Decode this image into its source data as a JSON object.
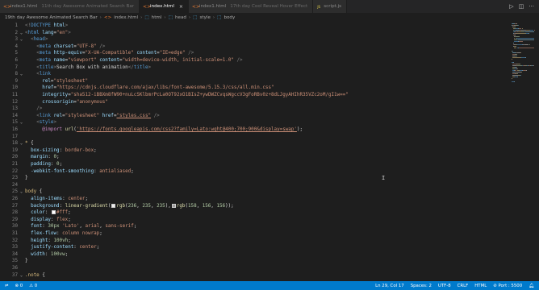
{
  "tabs": [
    {
      "label": "index1.html",
      "hint": "11th day Awesome Animated Search Bar",
      "icon": "html-icon",
      "active": false
    },
    {
      "label": "index.html",
      "hint": "",
      "icon": "html-icon",
      "active": true
    },
    {
      "label": "index1.html",
      "hint": "17th day Cool Reveal Hover Effect",
      "icon": "html-icon",
      "active": false
    },
    {
      "label": "script.js",
      "hint": "",
      "icon": "js-icon",
      "active": false
    }
  ],
  "tab_actions": {
    "run": "▷",
    "split": "◫",
    "more": "···"
  },
  "breadcrumb": {
    "folder": "19th day Awesome Animated Search Bar",
    "file": "index.html",
    "items": [
      "html",
      "head",
      "style",
      "body"
    ]
  },
  "code_lines": [
    {
      "n": "1",
      "tokens": [
        [
          "t-punc",
          "<!"
        ],
        [
          "t-tag",
          "DOCTYPE"
        ],
        [
          "t-attr",
          " html"
        ],
        [
          "t-punc",
          ">"
        ]
      ]
    },
    {
      "n": "2",
      "tokens": [
        [
          "t-punc",
          "<"
        ],
        [
          "t-tag",
          "html"
        ],
        [
          "t-attr",
          " lang"
        ],
        [
          "t-txt",
          "="
        ],
        [
          "t-str",
          "\"en\""
        ],
        [
          "t-punc",
          ">"
        ]
      ]
    },
    {
      "n": "3",
      "tokens": [
        [
          "t-txt",
          "  "
        ],
        [
          "t-punc",
          "<"
        ],
        [
          "t-tag",
          "head"
        ],
        [
          "t-punc",
          ">"
        ]
      ]
    },
    {
      "n": "4",
      "tokens": [
        [
          "t-txt",
          "    "
        ],
        [
          "t-punc",
          "<"
        ],
        [
          "t-tag",
          "meta"
        ],
        [
          "t-attr",
          " charset"
        ],
        [
          "t-txt",
          "="
        ],
        [
          "t-str",
          "\"UTF-8\""
        ],
        [
          "t-txt",
          " "
        ],
        [
          "t-punc",
          "/>"
        ]
      ]
    },
    {
      "n": "5",
      "tokens": [
        [
          "t-txt",
          "    "
        ],
        [
          "t-punc",
          "<"
        ],
        [
          "t-tag",
          "meta"
        ],
        [
          "t-attr",
          " http-equiv"
        ],
        [
          "t-txt",
          "="
        ],
        [
          "t-str",
          "\"X-UA-Compatible\""
        ],
        [
          "t-attr",
          " content"
        ],
        [
          "t-txt",
          "="
        ],
        [
          "t-str",
          "\"IE=edge\""
        ],
        [
          "t-txt",
          " "
        ],
        [
          "t-punc",
          "/>"
        ]
      ]
    },
    {
      "n": "6",
      "tokens": [
        [
          "t-txt",
          "    "
        ],
        [
          "t-punc",
          "<"
        ],
        [
          "t-tag",
          "meta"
        ],
        [
          "t-attr",
          " name"
        ],
        [
          "t-txt",
          "="
        ],
        [
          "t-str",
          "\"viewport\""
        ],
        [
          "t-attr",
          " content"
        ],
        [
          "t-txt",
          "="
        ],
        [
          "t-str",
          "\"width=device-width, initial-scale=1.0\""
        ],
        [
          "t-txt",
          " "
        ],
        [
          "t-punc",
          "/>"
        ]
      ]
    },
    {
      "n": "7",
      "tokens": [
        [
          "t-txt",
          "    "
        ],
        [
          "t-punc",
          "<"
        ],
        [
          "t-tag",
          "title"
        ],
        [
          "t-punc",
          ">"
        ],
        [
          "t-txt",
          "Search Box with animation"
        ],
        [
          "t-punc",
          "</"
        ],
        [
          "t-tag",
          "title"
        ],
        [
          "t-punc",
          ">"
        ]
      ]
    },
    {
      "n": "8",
      "tokens": [
        [
          "t-txt",
          "    "
        ],
        [
          "t-punc",
          "<"
        ],
        [
          "t-tag",
          "link"
        ]
      ]
    },
    {
      "n": "9",
      "tokens": [
        [
          "t-txt",
          "      "
        ],
        [
          "t-attr",
          "rel"
        ],
        [
          "t-txt",
          "="
        ],
        [
          "t-str",
          "\"stylesheet\""
        ]
      ]
    },
    {
      "n": "10",
      "tokens": [
        [
          "t-txt",
          "      "
        ],
        [
          "t-attr",
          "href"
        ],
        [
          "t-txt",
          "="
        ],
        [
          "t-str",
          "\"https://cdnjs.cloudflare.com/ajax/libs/font-awesome/5.15.3/css/all.min.css\""
        ]
      ]
    },
    {
      "n": "11",
      "tokens": [
        [
          "t-txt",
          "      "
        ],
        [
          "t-attr",
          "integrity"
        ],
        [
          "t-txt",
          "="
        ],
        [
          "t-str",
          "\"sha512-iBBXm8fW90+nuLcSKlbmrPcLa0OT92xO1BIsZ+ywDWZCvqsWgccV3gFoRBv0z+8dLJgyAHIhR35VZc2oM/gI1w==\""
        ]
      ]
    },
    {
      "n": "12",
      "tokens": [
        [
          "t-txt",
          "      "
        ],
        [
          "t-attr",
          "crossorigin"
        ],
        [
          "t-txt",
          "="
        ],
        [
          "t-str",
          "\"anonymous\""
        ]
      ]
    },
    {
      "n": "13",
      "tokens": [
        [
          "t-txt",
          "    "
        ],
        [
          "t-punc",
          "/>"
        ]
      ]
    },
    {
      "n": "14",
      "tokens": [
        [
          "t-txt",
          "    "
        ],
        [
          "t-punc",
          "<"
        ],
        [
          "t-tag",
          "link"
        ],
        [
          "t-attr",
          " rel"
        ],
        [
          "t-txt",
          "="
        ],
        [
          "t-str",
          "\"stylesheet\""
        ],
        [
          "t-attr",
          " href"
        ],
        [
          "t-txt",
          "="
        ],
        [
          "t-url",
          "\"styles.css\""
        ],
        [
          "t-txt",
          " "
        ],
        [
          "t-punc",
          "/>"
        ]
      ]
    },
    {
      "n": "15",
      "tokens": [
        [
          "t-txt",
          "    "
        ],
        [
          "t-punc",
          "<"
        ],
        [
          "t-tag",
          "style"
        ],
        [
          "t-punc",
          ">"
        ]
      ]
    },
    {
      "n": "16",
      "tokens": [
        [
          "t-txt",
          "      "
        ],
        [
          "t-kw",
          "@import"
        ],
        [
          "t-txt",
          " "
        ],
        [
          "t-fn",
          "url"
        ],
        [
          "t-txt",
          "("
        ],
        [
          "t-url",
          "'https://fonts.googleapis.com/css2?family=Lato:wght@400;700;900&display=swap'"
        ],
        [
          "t-txt",
          ");"
        ]
      ]
    },
    {
      "n": "17",
      "tokens": []
    },
    {
      "n": "18",
      "tokens": [
        [
          "t-sel",
          "* "
        ],
        [
          "t-txt",
          "{"
        ]
      ]
    },
    {
      "n": "19",
      "tokens": [
        [
          "t-txt",
          "  "
        ],
        [
          "t-prop",
          "box-sizing"
        ],
        [
          "t-txt",
          ": "
        ],
        [
          "t-val",
          "border-box"
        ],
        [
          "t-txt",
          ";"
        ]
      ]
    },
    {
      "n": "20",
      "tokens": [
        [
          "t-txt",
          "  "
        ],
        [
          "t-prop",
          "margin"
        ],
        [
          "t-txt",
          ": "
        ],
        [
          "t-num",
          "0"
        ],
        [
          "t-txt",
          ";"
        ]
      ]
    },
    {
      "n": "21",
      "tokens": [
        [
          "t-txt",
          "  "
        ],
        [
          "t-prop",
          "padding"
        ],
        [
          "t-txt",
          ": "
        ],
        [
          "t-num",
          "0"
        ],
        [
          "t-txt",
          ";"
        ]
      ]
    },
    {
      "n": "22",
      "tokens": [
        [
          "t-txt",
          "  "
        ],
        [
          "t-prop",
          "-webkit-font-smoothing"
        ],
        [
          "t-txt",
          ": "
        ],
        [
          "t-val",
          "antialiased"
        ],
        [
          "t-txt",
          ";"
        ]
      ]
    },
    {
      "n": "23",
      "tokens": [
        [
          "t-txt",
          "}"
        ]
      ]
    },
    {
      "n": "24",
      "tokens": []
    },
    {
      "n": "25",
      "tokens": [
        [
          "t-sel",
          "body "
        ],
        [
          "t-txt",
          "{"
        ]
      ]
    },
    {
      "n": "26",
      "tokens": [
        [
          "t-txt",
          "  "
        ],
        [
          "t-prop",
          "align-items"
        ],
        [
          "t-txt",
          ": "
        ],
        [
          "t-val",
          "center"
        ],
        [
          "t-txt",
          ";"
        ]
      ]
    },
    {
      "n": "27",
      "tokens": [
        [
          "t-txt",
          "  "
        ],
        [
          "t-prop",
          "background"
        ],
        [
          "t-txt",
          ": "
        ],
        [
          "t-fn",
          "linear-gradient"
        ],
        [
          "t-txt",
          "("
        ],
        [
          "swatch",
          "#ecebeb"
        ],
        [
          "t-fn",
          "rgb"
        ],
        [
          "t-txt",
          "("
        ],
        [
          "t-num",
          "236"
        ],
        [
          "t-txt",
          ", "
        ],
        [
          "t-num",
          "235"
        ],
        [
          "t-txt",
          ", "
        ],
        [
          "t-num",
          "235"
        ],
        [
          "t-txt",
          "),"
        ],
        [
          "swatch",
          "#9e9c9c"
        ],
        [
          "t-fn",
          "rgb"
        ],
        [
          "t-txt",
          "("
        ],
        [
          "t-num",
          "158"
        ],
        [
          "t-txt",
          ", "
        ],
        [
          "t-num",
          "156"
        ],
        [
          "t-txt",
          ", "
        ],
        [
          "t-num",
          "156"
        ],
        [
          "t-txt",
          "));"
        ]
      ]
    },
    {
      "n": "28",
      "tokens": [
        [
          "t-txt",
          "  "
        ],
        [
          "t-prop",
          "color"
        ],
        [
          "t-txt",
          ": "
        ],
        [
          "swatch",
          "#ffffff"
        ],
        [
          "t-val",
          "#fff"
        ],
        [
          "t-txt",
          ";"
        ]
      ]
    },
    {
      "n": "29",
      "tokens": [
        [
          "t-txt",
          "  "
        ],
        [
          "t-prop",
          "display"
        ],
        [
          "t-txt",
          ": "
        ],
        [
          "t-val",
          "flex"
        ],
        [
          "t-txt",
          ";"
        ]
      ]
    },
    {
      "n": "30",
      "tokens": [
        [
          "t-txt",
          "  "
        ],
        [
          "t-prop",
          "font"
        ],
        [
          "t-txt",
          ": "
        ],
        [
          "t-num",
          "30px"
        ],
        [
          "t-txt",
          " "
        ],
        [
          "t-val",
          "'Lato'"
        ],
        [
          "t-txt",
          ", "
        ],
        [
          "t-val",
          "arial"
        ],
        [
          "t-txt",
          ", "
        ],
        [
          "t-val",
          "sans-serif"
        ],
        [
          "t-txt",
          ";"
        ]
      ]
    },
    {
      "n": "31",
      "tokens": [
        [
          "t-txt",
          "  "
        ],
        [
          "t-prop",
          "flex-flow"
        ],
        [
          "t-txt",
          ": "
        ],
        [
          "t-val",
          "column nowrap"
        ],
        [
          "t-txt",
          ";"
        ]
      ]
    },
    {
      "n": "32",
      "tokens": [
        [
          "t-txt",
          "  "
        ],
        [
          "t-prop",
          "height"
        ],
        [
          "t-txt",
          ": "
        ],
        [
          "t-num",
          "100vh"
        ],
        [
          "t-txt",
          ";"
        ]
      ]
    },
    {
      "n": "33",
      "tokens": [
        [
          "t-txt",
          "  "
        ],
        [
          "t-prop",
          "justify-content"
        ],
        [
          "t-txt",
          ": "
        ],
        [
          "t-val",
          "center"
        ],
        [
          "t-txt",
          ";"
        ]
      ]
    },
    {
      "n": "34",
      "tokens": [
        [
          "t-txt",
          "  "
        ],
        [
          "t-prop",
          "width"
        ],
        [
          "t-txt",
          ": "
        ],
        [
          "t-num",
          "100vw"
        ],
        [
          "t-txt",
          ";"
        ]
      ]
    },
    {
      "n": "35",
      "tokens": [
        [
          "t-txt",
          "}"
        ]
      ]
    },
    {
      "n": "36",
      "tokens": []
    },
    {
      "n": "37",
      "tokens": [
        [
          "t-sel",
          ".note "
        ],
        [
          "t-txt",
          "{"
        ]
      ]
    }
  ],
  "status": {
    "branch_icon": "remote-icon",
    "errors": "⊗ 0",
    "warnings": "⚠ 0",
    "position": "Ln 29, Col 17",
    "spaces": "Spaces: 2",
    "encoding": "UTF-8",
    "eol": "CRLF",
    "language": "HTML",
    "port": "⊘ Port : 5500",
    "feedback_icon": "bell-icon"
  },
  "colors": {
    "statusbar": "#007acc",
    "editor_bg": "#1e1e1e",
    "tabbar_bg": "#252526"
  }
}
